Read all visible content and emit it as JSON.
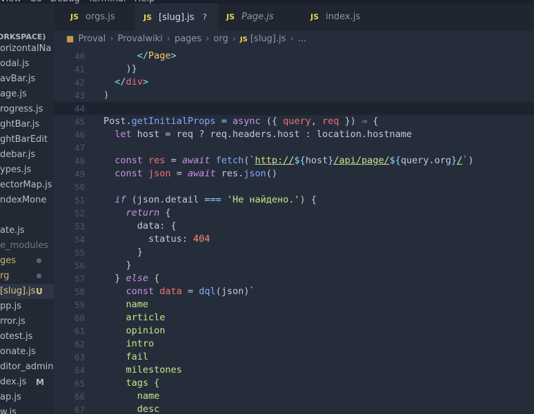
{
  "menubar": {
    "items": [
      "View",
      "Go",
      "Debug",
      "Terminal",
      "Help"
    ]
  },
  "sidebar": {
    "workspace_header": "ORKSPACE)",
    "files": [
      {
        "label": "orizontalNa",
        "style": "normal",
        "badge": ""
      },
      {
        "label": "odal.js",
        "style": "normal",
        "badge": ""
      },
      {
        "label": "avBar.js",
        "style": "normal",
        "badge": ""
      },
      {
        "label": "age.js",
        "style": "normal",
        "badge": ""
      },
      {
        "label": "rogress.js",
        "style": "normal",
        "badge": ""
      },
      {
        "label": "ghtBar.js",
        "style": "normal",
        "badge": ""
      },
      {
        "label": "ghtBarEdit",
        "style": "normal",
        "badge": ""
      },
      {
        "label": "debar.js",
        "style": "normal",
        "badge": ""
      },
      {
        "label": "ypes.js",
        "style": "normal",
        "badge": ""
      },
      {
        "label": "ectorMap.js",
        "style": "normal",
        "badge": ""
      },
      {
        "label": "ndexMone",
        "style": "normal",
        "badge": ""
      },
      {
        "label": "",
        "style": "normal",
        "badge": ""
      },
      {
        "label": "ate.js",
        "style": "normal",
        "badge": ""
      },
      {
        "label": "e_modules",
        "style": "dim",
        "badge": ""
      },
      {
        "label": "ges",
        "style": "git-mod",
        "badge": "dot"
      },
      {
        "label": "rg",
        "style": "git-mod",
        "badge": "dot"
      },
      {
        "label": "[slug].js",
        "style": "active",
        "badge": "U"
      },
      {
        "label": "pp.js",
        "style": "normal",
        "badge": ""
      },
      {
        "label": "rror.js",
        "style": "normal",
        "badge": ""
      },
      {
        "label": "otest.js",
        "style": "normal",
        "badge": ""
      },
      {
        "label": "onate.js",
        "style": "normal",
        "badge": ""
      },
      {
        "label": "ditor_admin",
        "style": "normal",
        "badge": ""
      },
      {
        "label": "dex.js",
        "style": "normal",
        "badge": "M"
      },
      {
        "label": "ap.js",
        "style": "normal",
        "badge": ""
      },
      {
        "label": "w.js",
        "style": "normal",
        "badge": ""
      }
    ]
  },
  "tabs": [
    {
      "icon": "JS",
      "label": "orgs.js",
      "active": false,
      "italic": false,
      "close": ""
    },
    {
      "icon": "JS",
      "label": "[slug].js",
      "active": true,
      "italic": false,
      "close": "?"
    },
    {
      "icon": "JS",
      "label": "Page.js",
      "active": false,
      "italic": true,
      "close": ""
    },
    {
      "icon": "JS",
      "label": "index.js",
      "active": false,
      "italic": false,
      "close": ""
    }
  ],
  "breadcrumb": {
    "items": [
      "Proval",
      "Provalwiki",
      "pages",
      "org"
    ],
    "file_icon": "JS",
    "file": "[slug].js",
    "tail": "..."
  },
  "colors": {
    "background": "#262d3a",
    "sidebar": "#222935",
    "keyword": "#c792ea",
    "function": "#82aaff",
    "string": "#c3e88d",
    "variable": "#f07178",
    "number": "#f78c6c",
    "js_icon": "#e8d44d"
  },
  "code": {
    "lines": [
      {
        "n": "40",
        "tokens": [
          [
            "c-plain",
            "      "
          ],
          [
            "c-tagp",
            "</"
          ],
          [
            "c-comp",
            "Page"
          ],
          [
            "c-tagp",
            ">"
          ]
        ]
      },
      {
        "n": "41",
        "tokens": [
          [
            "c-plain",
            "    )}"
          ]
        ]
      },
      {
        "n": "42",
        "tokens": [
          [
            "c-plain",
            "  "
          ],
          [
            "c-tagp",
            "</"
          ],
          [
            "c-tag",
            "div"
          ],
          [
            "c-tagp",
            ">"
          ]
        ]
      },
      {
        "n": "43",
        "tokens": [
          [
            "c-plain",
            ")"
          ]
        ]
      },
      {
        "n": "44",
        "tokens": [
          [
            "c-plain",
            ""
          ]
        ]
      },
      {
        "n": "45",
        "tokens": [
          [
            "c-plain",
            "Post."
          ],
          [
            "c-fn",
            "getInitialProps"
          ],
          [
            "c-plain",
            " "
          ],
          [
            "c-op",
            "="
          ],
          [
            "c-plain",
            " "
          ],
          [
            "c-kw",
            "async"
          ],
          [
            "c-plain",
            " ({ "
          ],
          [
            "c-var",
            "query"
          ],
          [
            "c-plain",
            ", "
          ],
          [
            "c-var",
            "req"
          ],
          [
            "c-plain",
            " }) "
          ],
          [
            "c-kw",
            "⇒"
          ],
          [
            "c-plain",
            " {"
          ]
        ]
      },
      {
        "n": "46",
        "tokens": [
          [
            "c-plain",
            "  "
          ],
          [
            "c-kw",
            "let"
          ],
          [
            "c-plain",
            " host = req ? req.headers.host : location.hostname"
          ]
        ]
      },
      {
        "n": "47",
        "tokens": [
          [
            "c-plain",
            ""
          ]
        ]
      },
      {
        "n": "48",
        "tokens": [
          [
            "c-plain",
            "  "
          ],
          [
            "c-kw",
            "const"
          ],
          [
            "c-plain",
            " "
          ],
          [
            "c-var",
            "res"
          ],
          [
            "c-plain",
            " = "
          ],
          [
            "c-kw-it",
            "await"
          ],
          [
            "c-plain",
            " "
          ],
          [
            "c-fn",
            "fetch"
          ],
          [
            "c-plain",
            "(`"
          ],
          [
            "c-url",
            "http://"
          ],
          [
            "c-interp",
            "${"
          ],
          [
            "c-plain",
            "host"
          ],
          [
            "c-interp",
            "}"
          ],
          [
            "c-url",
            "/api/page/"
          ],
          [
            "c-interp",
            "${"
          ],
          [
            "c-plain",
            "query.org"
          ],
          [
            "c-interp",
            "}"
          ],
          [
            "c-url",
            "/"
          ],
          [
            "c-plain",
            "`)"
          ]
        ]
      },
      {
        "n": "49",
        "tokens": [
          [
            "c-plain",
            "  "
          ],
          [
            "c-kw",
            "const"
          ],
          [
            "c-plain",
            " "
          ],
          [
            "c-var",
            "json"
          ],
          [
            "c-plain",
            " = "
          ],
          [
            "c-kw-it",
            "await"
          ],
          [
            "c-plain",
            " res."
          ],
          [
            "c-fn",
            "json"
          ],
          [
            "c-plain",
            "()"
          ]
        ]
      },
      {
        "n": "50",
        "tokens": [
          [
            "c-plain",
            ""
          ]
        ]
      },
      {
        "n": "51",
        "tokens": [
          [
            "c-plain",
            "  "
          ],
          [
            "c-kw-it",
            "if"
          ],
          [
            "c-plain",
            " (json.detail "
          ],
          [
            "c-op",
            "==="
          ],
          [
            "c-plain",
            " "
          ],
          [
            "c-str",
            "'Не найдено.'"
          ],
          [
            "c-plain",
            ") {"
          ]
        ]
      },
      {
        "n": "52",
        "tokens": [
          [
            "c-plain",
            "    "
          ],
          [
            "c-kw-it",
            "return"
          ],
          [
            "c-plain",
            " {"
          ]
        ]
      },
      {
        "n": "53",
        "tokens": [
          [
            "c-plain",
            "      data: {"
          ]
        ]
      },
      {
        "n": "54",
        "tokens": [
          [
            "c-plain",
            "        status: "
          ],
          [
            "c-num",
            "404"
          ]
        ]
      },
      {
        "n": "55",
        "tokens": [
          [
            "c-plain",
            "      }"
          ]
        ]
      },
      {
        "n": "56",
        "tokens": [
          [
            "c-plain",
            "    }"
          ]
        ]
      },
      {
        "n": "57",
        "tokens": [
          [
            "c-plain",
            "  } "
          ],
          [
            "c-kw-it",
            "else"
          ],
          [
            "c-plain",
            " {"
          ]
        ]
      },
      {
        "n": "58",
        "tokens": [
          [
            "c-plain",
            "    "
          ],
          [
            "c-kw",
            "const"
          ],
          [
            "c-plain",
            " "
          ],
          [
            "c-var",
            "data"
          ],
          [
            "c-plain",
            " = "
          ],
          [
            "c-fn",
            "dql"
          ],
          [
            "c-plain",
            "(json)`"
          ]
        ]
      },
      {
        "n": "59",
        "tokens": [
          [
            "c-str",
            "    name"
          ]
        ]
      },
      {
        "n": "60",
        "tokens": [
          [
            "c-str",
            "    article"
          ]
        ]
      },
      {
        "n": "61",
        "tokens": [
          [
            "c-str",
            "    opinion"
          ]
        ]
      },
      {
        "n": "62",
        "tokens": [
          [
            "c-str",
            "    intro"
          ]
        ]
      },
      {
        "n": "63",
        "tokens": [
          [
            "c-str",
            "    fail"
          ]
        ]
      },
      {
        "n": "64",
        "tokens": [
          [
            "c-str",
            "    milestones"
          ]
        ]
      },
      {
        "n": "65",
        "tokens": [
          [
            "c-str",
            "    tags {"
          ]
        ]
      },
      {
        "n": "66",
        "tokens": [
          [
            "c-str",
            "      name"
          ]
        ]
      },
      {
        "n": "67",
        "tokens": [
          [
            "c-str",
            "      desc"
          ]
        ]
      }
    ]
  }
}
